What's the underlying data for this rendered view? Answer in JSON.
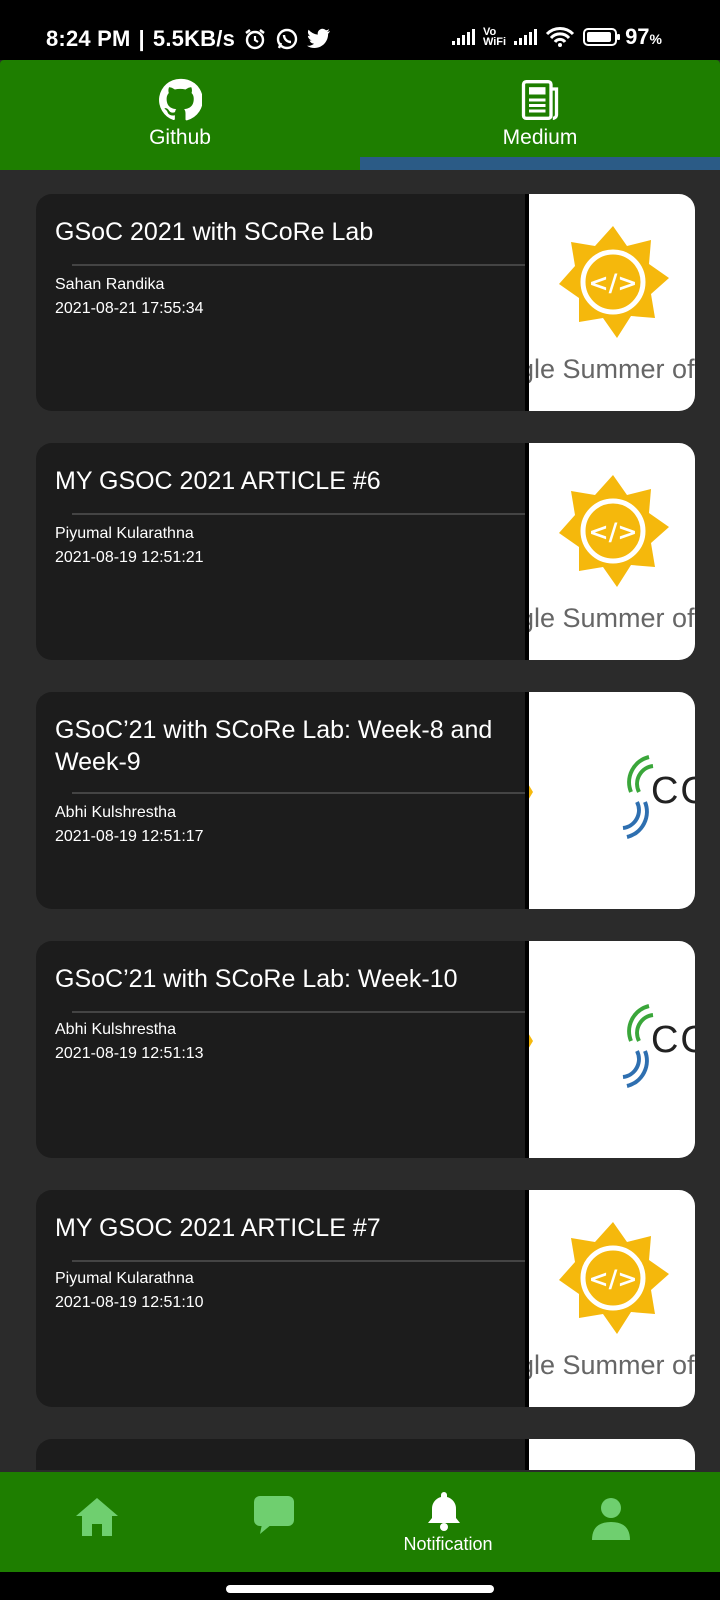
{
  "status_bar": {
    "time": "8:24 PM",
    "speed": "5.5KB/s",
    "vowifi": "Vo\nWiFi",
    "battery": "97",
    "battery_unit": "%"
  },
  "top_tabs": [
    {
      "label": "Github",
      "icon": "github-icon",
      "selected": false
    },
    {
      "label": "Medium",
      "icon": "article-icon",
      "selected": true
    }
  ],
  "articles": [
    {
      "title": "GSoC 2021 with SCoRe Lab",
      "author": "Sahan Randika",
      "date": "2021-08-21 17:55:34",
      "thumb": "gsoc",
      "thumb_text": "gle Summer of"
    },
    {
      "title": "MY GSOC 2021 ARTICLE #6",
      "author": "Piyumal Kularathna",
      "date": "2021-08-19 12:51:21",
      "thumb": "gsoc",
      "thumb_text": "gle Summer of"
    },
    {
      "title": "GSoC’21 with SCoRe Lab: Week-8 and Week-9",
      "author": "Abhi Kulshrestha",
      "date": "2021-08-19 12:51:17",
      "thumb": "score",
      "thumb_text": "CO"
    },
    {
      "title": "GSoC’21 with SCoRe Lab: Week-10",
      "author": "Abhi Kulshrestha",
      "date": "2021-08-19 12:51:13",
      "thumb": "score",
      "thumb_text": "CO"
    },
    {
      "title": "MY GSOC 2021 ARTICLE #7",
      "author": "Piyumal Kularathna",
      "date": "2021-08-19 12:51:10",
      "thumb": "gsoc",
      "thumb_text": "gle Summer of"
    }
  ],
  "bottom_nav": [
    {
      "icon": "home-icon",
      "label": ""
    },
    {
      "icon": "chat-icon",
      "label": ""
    },
    {
      "icon": "bell-icon",
      "label": "Notification",
      "selected": true
    },
    {
      "icon": "person-icon",
      "label": ""
    }
  ],
  "colors": {
    "primary": "#1e7e00",
    "tab_indicator": "#2b5b86",
    "card": "#1c1c1c",
    "background": "#2b2b2b",
    "icon_inactive": "#6fcf6f"
  }
}
